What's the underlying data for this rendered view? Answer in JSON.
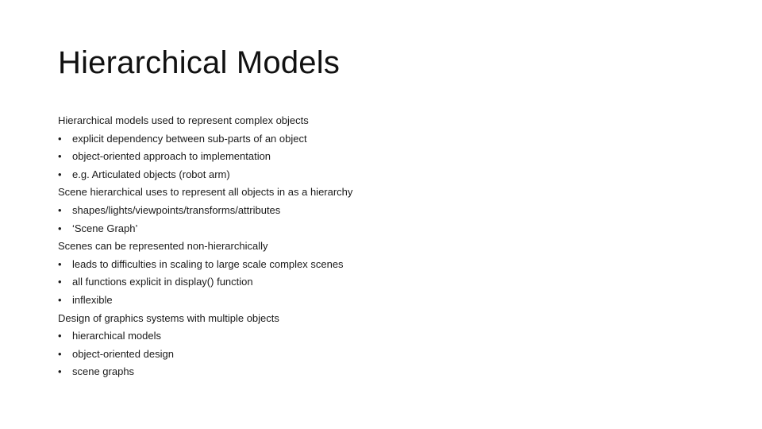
{
  "slide": {
    "title": "Hierarchical Models",
    "bullet_glyph": "•",
    "lines": [
      {
        "level": 0,
        "text": "Hierarchical models used to represent complex objects"
      },
      {
        "level": 1,
        "text": "explicit dependency between sub-parts of an object"
      },
      {
        "level": 1,
        "text": "object-oriented approach to implementation"
      },
      {
        "level": 1,
        "text": "e.g. Articulated objects (robot arm)"
      },
      {
        "level": 0,
        "text": "Scene hierarchical uses to represent all objects in as a hierarchy"
      },
      {
        "level": 1,
        "text": "shapes/lights/viewpoints/transforms/attributes"
      },
      {
        "level": 1,
        "text": "‘Scene Graph’"
      },
      {
        "level": 0,
        "text": "Scenes can be represented non-hierarchically"
      },
      {
        "level": 1,
        "text": "leads to difficulties in scaling to large scale complex scenes"
      },
      {
        "level": 1,
        "text": "all functions explicit in display() function"
      },
      {
        "level": 1,
        "text": "inflexible"
      },
      {
        "level": 0,
        "text": "Design of graphics systems with multiple objects"
      },
      {
        "level": 1,
        "text": "hierarchical models"
      },
      {
        "level": 1,
        "text": "object-oriented design"
      },
      {
        "level": 1,
        "text": "scene graphs"
      }
    ]
  }
}
